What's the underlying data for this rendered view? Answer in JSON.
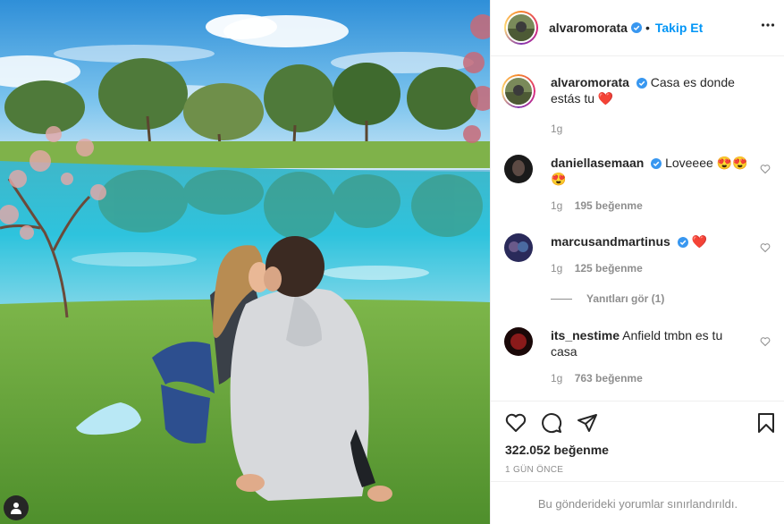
{
  "header": {
    "username": "alvaromorata",
    "separator": "•",
    "follow_label": "Takip Et"
  },
  "comments": [
    {
      "username": "alvaromorata",
      "text": "Casa es donde estás tu",
      "emoji": "❤️",
      "time": "1g",
      "likes": "",
      "verified": true
    },
    {
      "username": "daniellasemaan",
      "text": "Loveeee",
      "emoji": "😍😍😍",
      "time": "1g",
      "likes": "195 beğenme",
      "verified": true
    },
    {
      "username": "marcusandmartinus",
      "text": "",
      "emoji": "❤️",
      "time": "1g",
      "likes": "125 beğenme",
      "verified": true
    },
    {
      "username": "its_nestime",
      "text": "Anfield tmbn es tu casa",
      "emoji": "",
      "time": "1g",
      "likes": "763 beğenme",
      "verified": false
    }
  ],
  "view_replies_label": "Yanıtları gör (1)",
  "likes_total": "322.052 beğenme",
  "post_time": "1 GÜN ÖNCE",
  "restricted_notice": "Bu gönderideki yorumlar sınırlandırıldı.",
  "colors": {
    "accent": "#0095f6",
    "verified": "#3897f0",
    "muted": "#8e8e8e",
    "heart": "#ed4956"
  },
  "icons": [
    "user-tag-icon",
    "verified-badge-icon",
    "more-options-icon",
    "heart-icon",
    "comment-icon",
    "share-icon",
    "bookmark-icon"
  ]
}
